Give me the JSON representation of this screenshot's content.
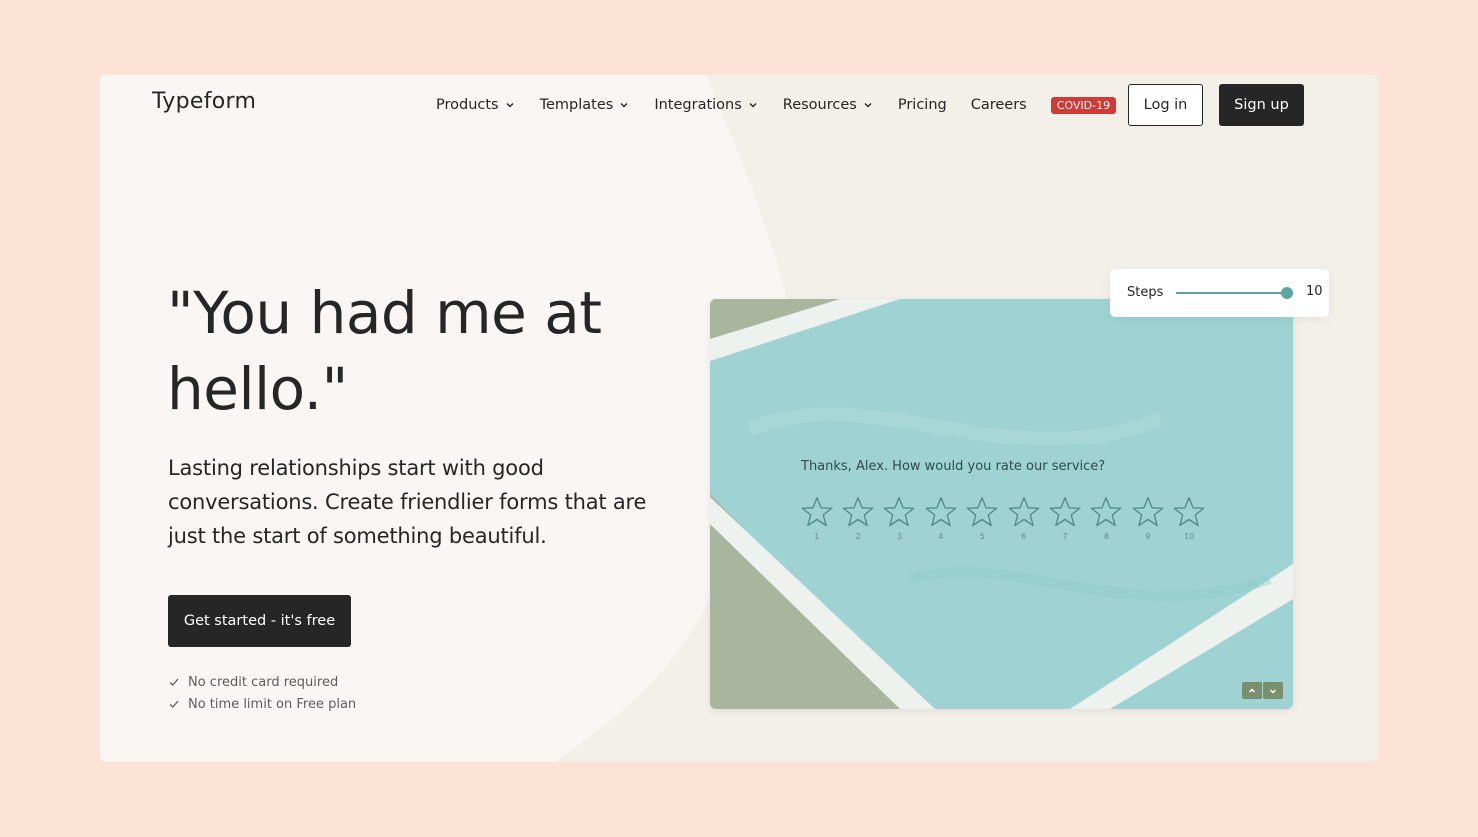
{
  "brand": {
    "logo": "Typeform",
    "accent": "#d13a35",
    "dark": "#262627",
    "page_bg": "#fde3d6",
    "slider_color": "#5ba7a0"
  },
  "nav": {
    "items": [
      {
        "label": "Products",
        "dropdown": true
      },
      {
        "label": "Templates",
        "dropdown": true
      },
      {
        "label": "Integrations",
        "dropdown": true
      },
      {
        "label": "Resources",
        "dropdown": true
      },
      {
        "label": "Pricing",
        "dropdown": false
      },
      {
        "label": "Careers",
        "dropdown": false
      }
    ],
    "badge": "COVID-19",
    "login": "Log in",
    "signup": "Sign up"
  },
  "hero": {
    "headline_line1": "\"You had me at",
    "headline_line2": "hello.\"",
    "subtext": "Lasting relationships start with good conversations. Create friendlier forms that are just the start of something beautiful.",
    "cta": "Get started - it's free",
    "checks": [
      "No credit card required",
      "No time limit on Free plan"
    ]
  },
  "preview": {
    "question": "Thanks, Alex. How would you rate our service?",
    "rating_labels": [
      "1",
      "2",
      "3",
      "4",
      "5",
      "6",
      "7",
      "8",
      "9",
      "10"
    ]
  },
  "steps": {
    "label": "Steps",
    "value": "10",
    "level": 10
  }
}
